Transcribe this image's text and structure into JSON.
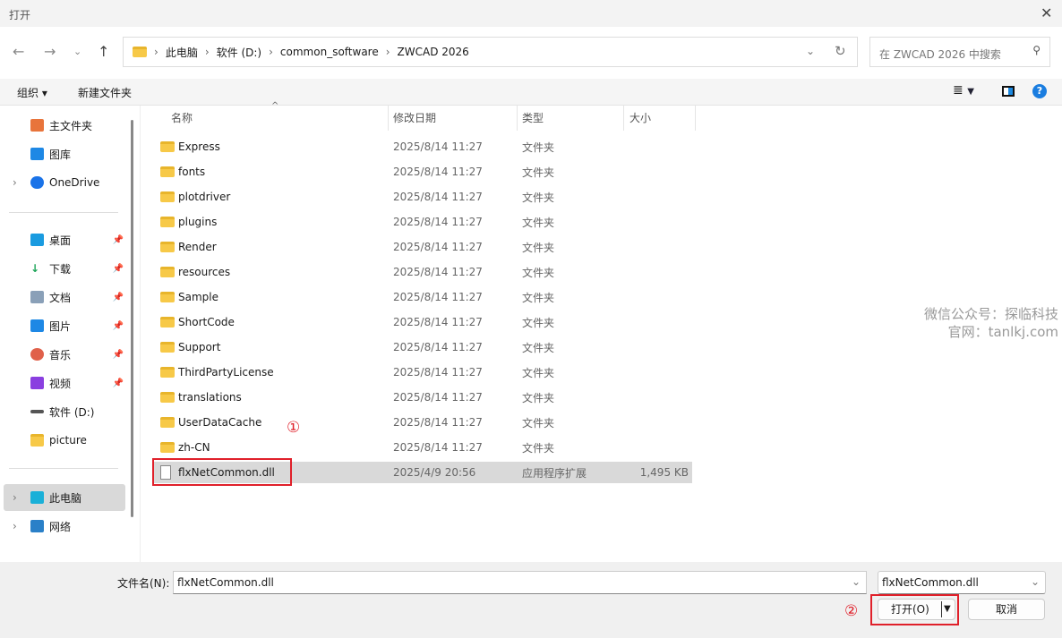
{
  "window": {
    "title": "打开"
  },
  "address": {
    "crumbs": [
      "此电脑",
      "软件 (D:)",
      "common_software",
      "ZWCAD 2026"
    ]
  },
  "search": {
    "placeholder": "在 ZWCAD 2026 中搜索"
  },
  "toolbar": {
    "organize": "组织",
    "new_folder": "新建文件夹"
  },
  "nav": {
    "items": [
      {
        "label": "主文件夹",
        "color": "#e8743b"
      },
      {
        "label": "图库",
        "color": "#1e88e5"
      },
      {
        "label": "OneDrive",
        "color": "#1a73e8"
      },
      {
        "label": "桌面",
        "color": "#1a9be0"
      },
      {
        "label": "下载",
        "color": "#1ea55a"
      },
      {
        "label": "文档",
        "color": "#8aa0b8"
      },
      {
        "label": "图片",
        "color": "#1e88e5"
      },
      {
        "label": "音乐",
        "color": "#e0604a"
      },
      {
        "label": "视频",
        "color": "#8a3fe0"
      },
      {
        "label": "软件 (D:)",
        "color": "#555555"
      },
      {
        "label": "picture",
        "color": "#f7c948"
      },
      {
        "label": "此电脑",
        "color": "#1ab0d8"
      },
      {
        "label": "网络",
        "color": "#2a80c8"
      }
    ]
  },
  "columns": {
    "name": "名称",
    "date": "修改日期",
    "type": "类型",
    "size": "大小"
  },
  "files": [
    {
      "name": "Express",
      "date": "2025/8/14 11:27",
      "type": "文件夹",
      "size": ""
    },
    {
      "name": "fonts",
      "date": "2025/8/14 11:27",
      "type": "文件夹",
      "size": ""
    },
    {
      "name": "plotdriver",
      "date": "2025/8/14 11:27",
      "type": "文件夹",
      "size": ""
    },
    {
      "name": "plugins",
      "date": "2025/8/14 11:27",
      "type": "文件夹",
      "size": ""
    },
    {
      "name": "Render",
      "date": "2025/8/14 11:27",
      "type": "文件夹",
      "size": ""
    },
    {
      "name": "resources",
      "date": "2025/8/14 11:27",
      "type": "文件夹",
      "size": ""
    },
    {
      "name": "Sample",
      "date": "2025/8/14 11:27",
      "type": "文件夹",
      "size": ""
    },
    {
      "name": "ShortCode",
      "date": "2025/8/14 11:27",
      "type": "文件夹",
      "size": ""
    },
    {
      "name": "Support",
      "date": "2025/8/14 11:27",
      "type": "文件夹",
      "size": ""
    },
    {
      "name": "ThirdPartyLicense",
      "date": "2025/8/14 11:27",
      "type": "文件夹",
      "size": ""
    },
    {
      "name": "translations",
      "date": "2025/8/14 11:27",
      "type": "文件夹",
      "size": ""
    },
    {
      "name": "UserDataCache",
      "date": "2025/8/14 11:27",
      "type": "文件夹",
      "size": ""
    },
    {
      "name": "zh-CN",
      "date": "2025/8/14 11:27",
      "type": "文件夹",
      "size": ""
    },
    {
      "name": "flxNetCommon.dll",
      "date": "2025/4/9 20:56",
      "type": "应用程序扩展",
      "size": "1,495 KB"
    }
  ],
  "bottom": {
    "filename_label": "文件名(N):",
    "filename_value": "flxNetCommon.dll",
    "filter_value": "flxNetCommon.dll",
    "open": "打开(O)",
    "cancel": "取消"
  },
  "annotations": {
    "step1": "①",
    "step2": "②"
  },
  "watermark": {
    "line1": "微信公众号：探临科技",
    "line2": "官网：tanlkj.com"
  }
}
